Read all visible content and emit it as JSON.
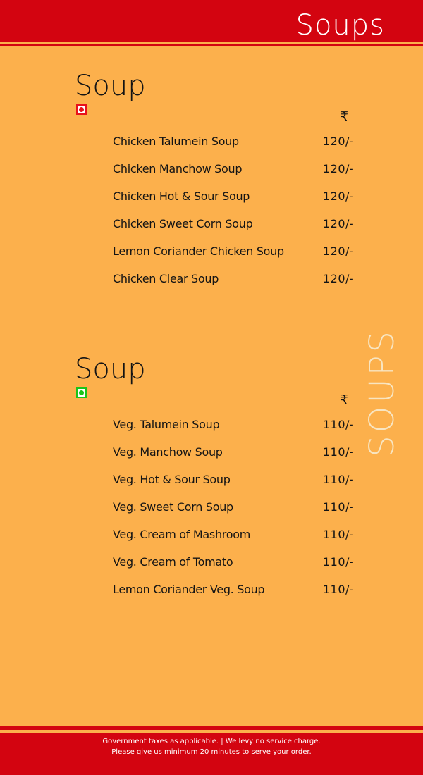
{
  "header": {
    "title": "Soups"
  },
  "side_label": "SOUPS",
  "sections": [
    {
      "title": "Soup",
      "diet_mark": "non-veg-red-mark",
      "mark_color": "#e8121b",
      "currency": "₹",
      "items": [
        {
          "name": "Chicken Talumein Soup",
          "price": "120/-"
        },
        {
          "name": "Chicken Manchow Soup",
          "price": "120/-"
        },
        {
          "name": "Chicken Hot & Sour Soup",
          "price": "120/-"
        },
        {
          "name": "Chicken Sweet Corn Soup",
          "price": "120/-"
        },
        {
          "name": "Lemon Coriander Chicken Soup",
          "price": "120/-"
        },
        {
          "name": "Chicken Clear Soup",
          "price": "120/-"
        }
      ]
    },
    {
      "title": "Soup",
      "diet_mark": "veg-green-mark",
      "mark_color": "#19c41b",
      "currency": "₹",
      "items": [
        {
          "name": "Veg. Talumein Soup",
          "price": "110/-"
        },
        {
          "name": "Veg. Manchow Soup",
          "price": "110/-"
        },
        {
          "name": "Veg. Hot & Sour Soup",
          "price": "110/-"
        },
        {
          "name": "Veg. Sweet Corn Soup",
          "price": "110/-"
        },
        {
          "name": "Veg. Cream of Mashroom",
          "price": "110/-"
        },
        {
          "name": "Veg. Cream of Tomato",
          "price": "110/-"
        },
        {
          "name": "Lemon Coriander Veg. Soup",
          "price": "110/-"
        }
      ]
    }
  ],
  "footer": {
    "line1": "Government taxes as applicable. | We levy no service charge.",
    "line2": "Please give us minimum 20 minutes to serve your order."
  }
}
